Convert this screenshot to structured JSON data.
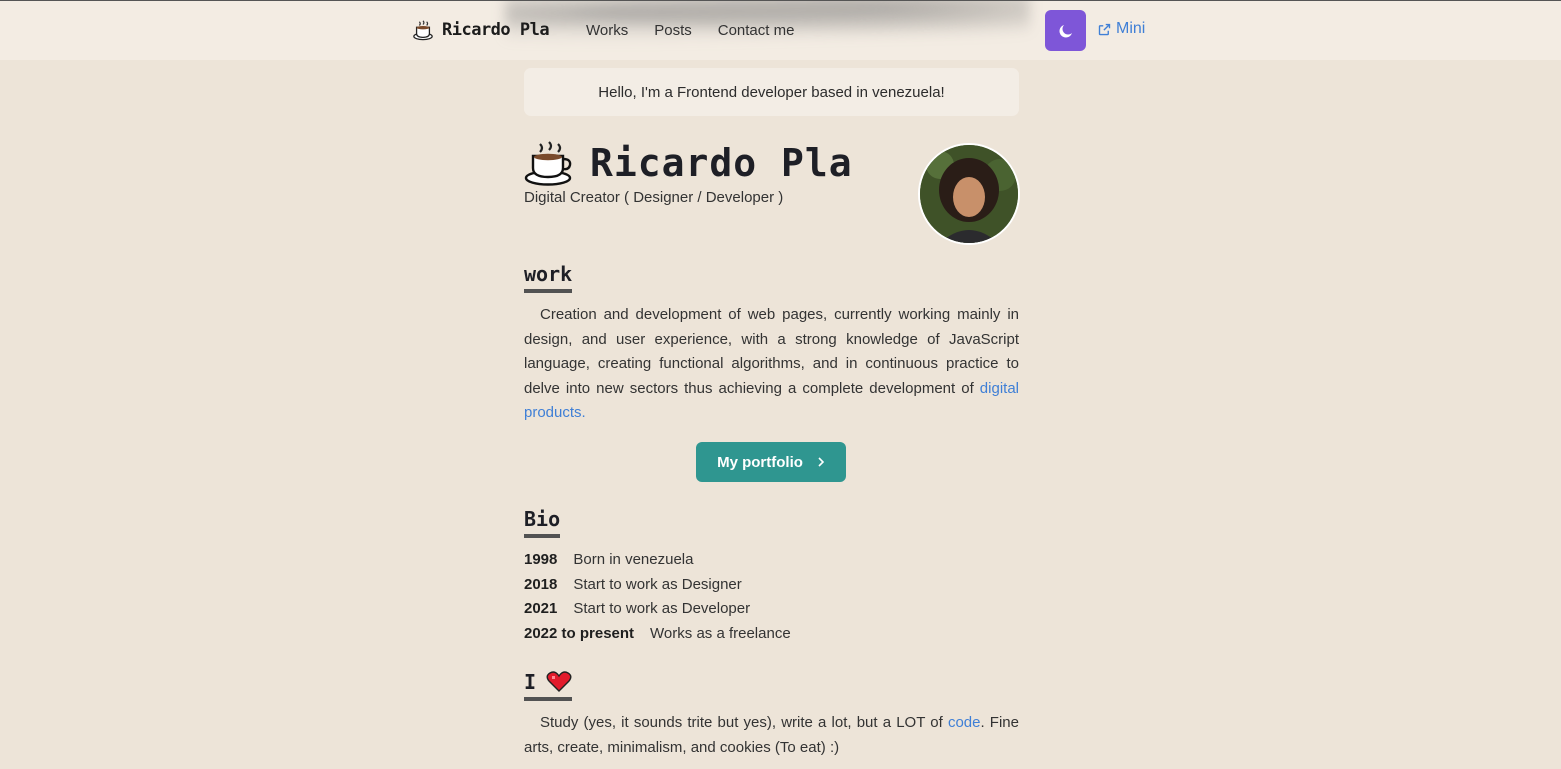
{
  "nav": {
    "brand": "Ricardo Pla",
    "links": [
      "Works",
      "Posts",
      "Contact me"
    ],
    "mini_label": "Mini"
  },
  "hero": {
    "hello": "Hello, I'm a Frontend developer based in venezuela!",
    "name": "Ricardo Pla",
    "subtitle": "Digital Creator ( Designer / Developer )"
  },
  "work": {
    "heading": "work",
    "text": "Creation and development of web pages, currently working mainly in design, and user experience, with a strong knowledge of JavaScript language, creating functional algorithms, and in continuous practice to delve into new sectors thus achieving a complete development of ",
    "link": "digital products.",
    "button": "My portfolio"
  },
  "bio": {
    "heading": "Bio",
    "items": [
      {
        "year": "1998",
        "text": "Born in venezuela"
      },
      {
        "year": "2018",
        "text": "Start to work as Designer"
      },
      {
        "year": "2021",
        "text": "Start to work as Developer"
      },
      {
        "year": "2022 to present",
        "text": "Works as a freelance"
      }
    ]
  },
  "love": {
    "heading": "I",
    "text_before": "Study (yes, it sounds trite but yes), write a lot, but a LOT of ",
    "link": "code",
    "text_after": ". Fine arts, create, minimalism, and cookies (To eat) :)"
  },
  "colors": {
    "background": "#ede4d8",
    "theme_button": "#7e56d8",
    "portfolio_button": "#2f9690",
    "link": "#3f7fd6"
  }
}
